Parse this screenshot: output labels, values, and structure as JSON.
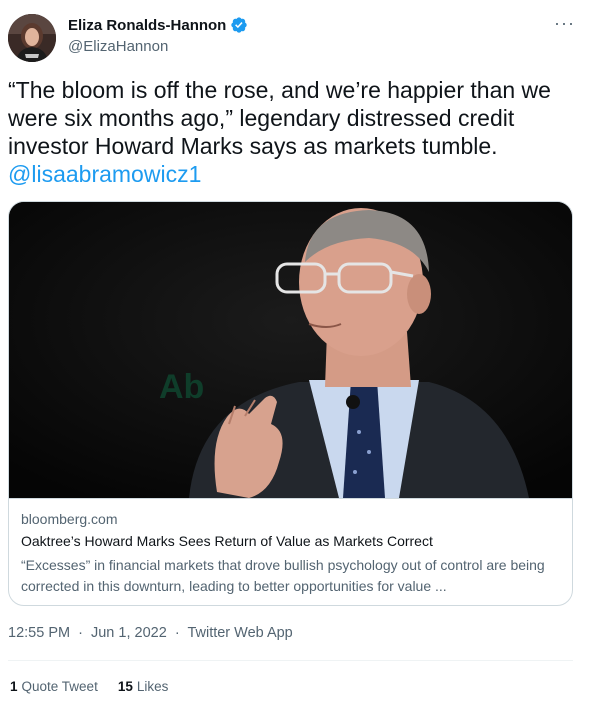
{
  "author": {
    "display_name": "Eliza Ronalds-Hannon",
    "handle": "@ElizaHannon",
    "verified": true
  },
  "menu_icon": "more-horizontal-icon",
  "tweet": {
    "text": "“The bloom is off the rose, and we’re happier than we were six months ago,” legendary distressed credit investor Howard Marks says as markets tumble.",
    "mention": "@lisaabramowicz1"
  },
  "card": {
    "domain": "bloomberg.com",
    "title": "Oaktree’s Howard Marks Sees Return of Value as Markets Correct",
    "description": "“Excesses” in financial markets that drove bullish psychology out of control are being corrected in this downturn, leading to better opportunities for value ..."
  },
  "meta": {
    "time": "12:55 PM",
    "separator": "·",
    "date": "Jun 1, 2022",
    "source": "Twitter Web App"
  },
  "stats": {
    "quote_count": "1",
    "quote_label": "Quote Tweet",
    "like_count": "15",
    "like_label": "Likes"
  },
  "colors": {
    "link": "#1d9bf0",
    "secondary_text": "#536471",
    "border": "#cfd9de"
  }
}
